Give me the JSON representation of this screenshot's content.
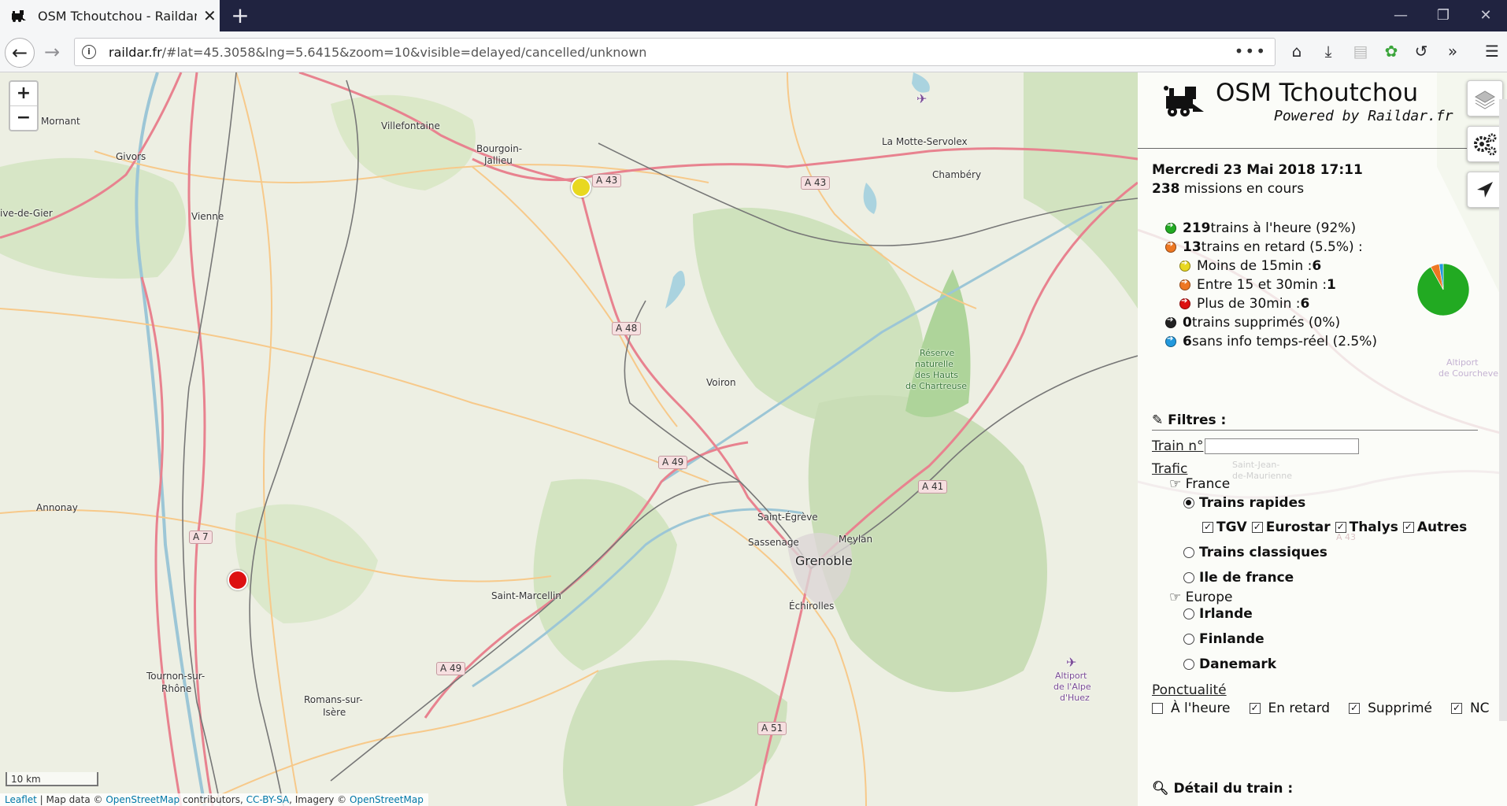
{
  "browser": {
    "tab_title": "OSM Tchoutchou - Raildar with",
    "url_host": "raildar.fr",
    "url_rest": "/#lat=45.3058&lng=5.6415&zoom=10&visible=delayed/cancelled/unknown",
    "new_tab": "+",
    "close": "✕",
    "menu_dots": "•••"
  },
  "map": {
    "zoom_in": "+",
    "zoom_out": "−",
    "scale": "10 km",
    "attribution": {
      "leaflet": "Leaflet",
      "mid1": " | Map data © ",
      "osm1": "OpenStreetMap",
      "mid2": " contributors, ",
      "license": "CC-BY-SA",
      "mid3": ", Imagery © ",
      "osm2": "OpenStreetMap"
    },
    "places": [
      "Mornant",
      "Givors",
      "Villefontaine",
      "Bourgoin-",
      "Jallieu",
      "Vienne",
      "ive-de-Gier",
      "La Motte-Servolex",
      "Chambéry",
      "Voiron",
      "Réserve",
      "naturelle",
      "des Hauts",
      "de Chartreuse",
      "Annonay",
      "Saint-Égrève",
      "Sassenage",
      "Meylan",
      "Grenoble",
      "Échirolles",
      "Saint-Marcellin",
      "Tournon-sur-",
      "Rhône",
      "Romans-sur-",
      "Isère",
      "Altiport",
      "de l'Alpe",
      "d'Huez"
    ],
    "roads": [
      "A 43",
      "A 43",
      "A 48",
      "A 49",
      "A 41",
      "A 7",
      "A 49",
      "A 51"
    ]
  },
  "sidebar": {
    "title": "OSM Tchoutchou",
    "subtitle": "Powered by Raildar.fr",
    "date": "Mercredi 23 Mai 2018 17:11",
    "missions_count": "238",
    "missions_label": " missions en cours",
    "stats": [
      {
        "bold": "219",
        "text": " trains à l'heure (92%)",
        "color": "#22aa22"
      },
      {
        "bold": "13",
        "text": " trains en retard (5.5%) :",
        "color": "#ee7722"
      },
      {
        "bold": "",
        "text": "Moins de 15min : ",
        "value": "6",
        "color": "#e8d820"
      },
      {
        "bold": "",
        "text": "Entre 15 et 30min : ",
        "value": "1",
        "color": "#ee7722"
      },
      {
        "bold": "",
        "text": "Plus de 30min : ",
        "value": "6",
        "color": "#dd1111"
      },
      {
        "bold": "0",
        "text": " trains supprimés (0%)",
        "color": "#222222"
      },
      {
        "bold": "6",
        "text": " sans info temps-réel (2.5%)",
        "color": "#2299dd"
      }
    ],
    "filters": {
      "title": "Filtres :",
      "train_label": "Train n°",
      "train_value": "",
      "trafic_label": "Trafic",
      "france": "France",
      "trains_rapides": "Trains rapides",
      "tgv": "TGV",
      "eurostar": "Eurostar",
      "thalys": "Thalys",
      "autres": "Autres",
      "trains_classiques": "Trains classiques",
      "ile_de_france": "Ile de france",
      "europe": "Europe",
      "irlande": "Irlande",
      "finlande": "Finlande",
      "danemark": "Danemark",
      "ponctualite_label": "Ponctualité",
      "a_lheure": "À l'heure",
      "en_retard": "En retard",
      "supprime": "Supprimé",
      "nc": "NC"
    },
    "detail_title": "Détail du train :",
    "bg_places": [
      "Altiport",
      "de Courchevel",
      "Saint-Jean-",
      "de-Maurienne",
      "A 43"
    ]
  },
  "chart_data": {
    "type": "pie",
    "categories": [
      "à l'heure",
      "en retard",
      "supprimés",
      "sans info"
    ],
    "values": [
      219,
      13,
      0,
      6
    ],
    "colors": [
      "#22aa22",
      "#ee7722",
      "#222222",
      "#2299dd"
    ]
  }
}
